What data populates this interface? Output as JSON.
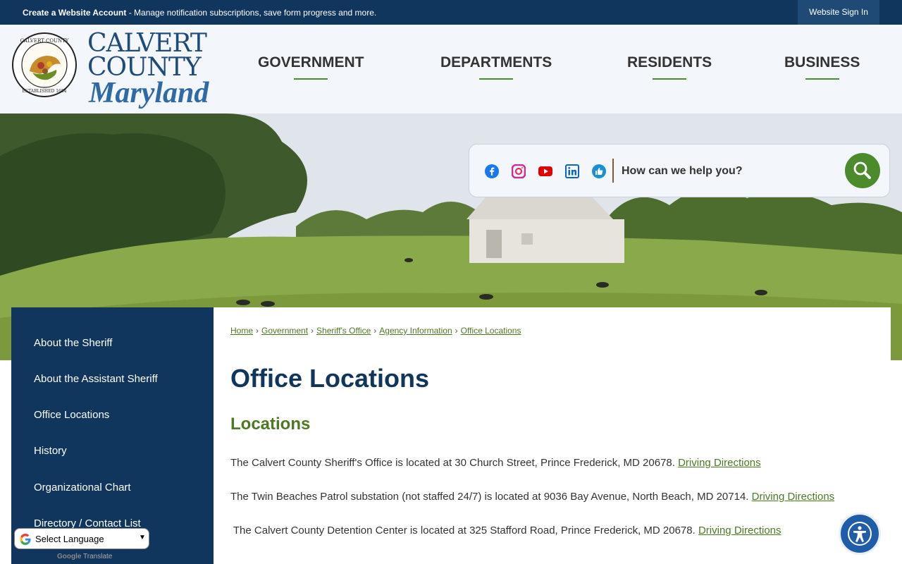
{
  "topbar": {
    "create_account_label": "Create a Website Account",
    "create_account_desc": " - Manage notification subscriptions, save form progress and more.",
    "signin_label": "Website Sign In"
  },
  "logo": {
    "line1": "CALVERT",
    "line2": "COUNTY",
    "line3": "Maryland",
    "seal_top": "CALVERT COUNTY",
    "seal_bottom": "ESTABLISHED 1654"
  },
  "nav": {
    "items": [
      {
        "label": "GOVERNMENT"
      },
      {
        "label": "DEPARTMENTS"
      },
      {
        "label": "RESIDENTS"
      },
      {
        "label": "BUSINESS"
      }
    ]
  },
  "search": {
    "placeholder": "How can we help you?",
    "social_icons": [
      "facebook-icon",
      "instagram-icon",
      "youtube-icon",
      "linkedin-icon",
      "thumbs-up-icon"
    ]
  },
  "sidebar": {
    "items": [
      {
        "label": "About the Sheriff"
      },
      {
        "label": "About the Assistant Sheriff"
      },
      {
        "label": "Office Locations"
      },
      {
        "label": "History"
      },
      {
        "label": "Organizational Chart"
      },
      {
        "label": "Directory / Contact List"
      }
    ]
  },
  "breadcrumb": {
    "items": [
      "Home",
      "Government",
      "Sheriff's Office",
      "Agency Information",
      "Office Locations"
    ],
    "separator": "›"
  },
  "main": {
    "title": "Office Locations",
    "section_title": "Locations",
    "paragraphs": [
      {
        "text": "The Calvert County Sheriff's Office is located at 30 Church Street, Prince Frederick, MD 20678. ",
        "link": "Driving Directions"
      },
      {
        "text": "The Twin Beaches Patrol substation (not staffed 24/7) is located at 9036 Bay Avenue, North Beach, MD 20714. ",
        "link": "Driving Directions"
      },
      {
        "text": " The Calvert County Detention Center is located at 325 Stafford Road, Prince Frederick, MD 20678. ",
        "link": "Driving Directions"
      }
    ]
  },
  "translate": {
    "select_label": "Select Language",
    "powered_by": "Google",
    "powered_suffix": " Translate"
  },
  "colors": {
    "navy": "#11365d",
    "green": "#4c8b2b",
    "link_green": "#4c7a22"
  }
}
